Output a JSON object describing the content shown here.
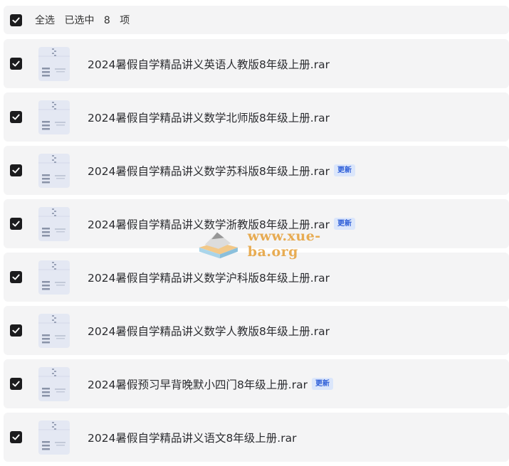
{
  "header": {
    "select_all_label": "全选",
    "selected_prefix": "已选中",
    "selected_count": "8",
    "selected_suffix": "项"
  },
  "files": [
    {
      "name": "2024暑假自学精品讲义英语人教版8年级上册.rar",
      "badge": ""
    },
    {
      "name": "2024暑假自学精品讲义数学北师版8年级上册.rar",
      "badge": ""
    },
    {
      "name": "2024暑假自学精品讲义数学苏科版8年级上册.rar",
      "badge": "更新"
    },
    {
      "name": "2024暑假自学精品讲义数学浙教版8年级上册.rar",
      "badge": "更新"
    },
    {
      "name": "2024暑假自学精品讲义数学沪科版8年级上册.rar",
      "badge": ""
    },
    {
      "name": "2024暑假自学精品讲义数学人教版8年级上册.rar",
      "badge": ""
    },
    {
      "name": "2024暑假预习早背晚默小四门8年级上册.rar",
      "badge": "更新"
    },
    {
      "name": "2024暑假自学精品讲义语文8年级上册.rar",
      "badge": ""
    }
  ],
  "watermark": {
    "text": "www.xue-ba.org"
  },
  "icons": {
    "checkbox": "checkbox-checked-icon",
    "file": "zip-archive-icon",
    "logo": "book-logo-icon"
  },
  "colors": {
    "row_bg": "#f4f4f5",
    "checkbox": "#1c1c1e",
    "badge_text": "#2f5fd8",
    "badge_bg": "#dbe6fb",
    "watermark": "#e6a23c"
  }
}
